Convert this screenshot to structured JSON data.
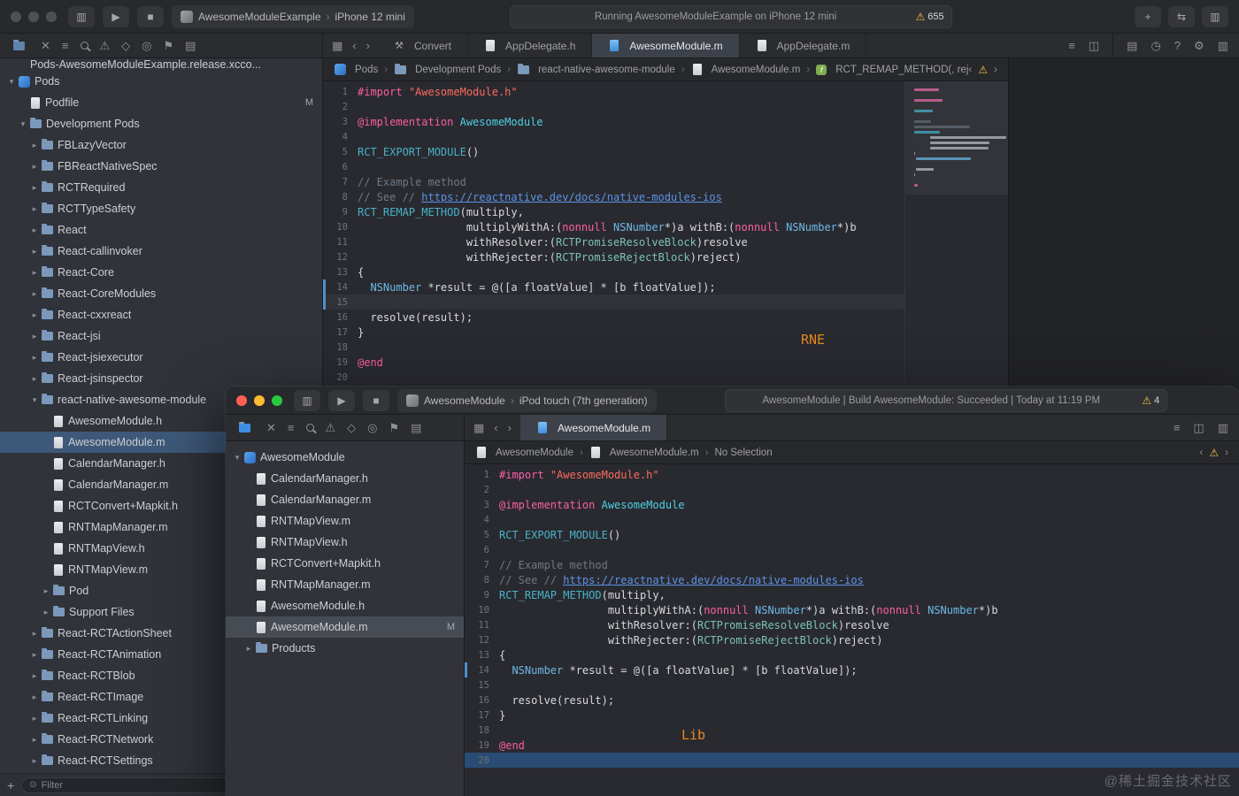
{
  "watermark": "@稀土掘金技术社区",
  "code": {
    "lines": [
      [
        [
          "kw",
          "#import"
        ],
        [
          "pl",
          " "
        ],
        [
          "str",
          "\"AwesomeModule.h\""
        ]
      ],
      [],
      [
        [
          "kw",
          "@implementation"
        ],
        [
          "pl",
          " "
        ],
        [
          "cy",
          "AwesomeModule"
        ]
      ],
      [],
      [
        [
          "mc",
          "RCT_EXPORT_MODULE"
        ],
        [
          "pl",
          "()"
        ]
      ],
      [],
      [
        [
          "cm",
          "// Example method"
        ]
      ],
      [
        [
          "cm",
          "// See // "
        ],
        [
          "lk",
          "https://reactnative.dev/docs/native-modules-ios"
        ]
      ],
      [
        [
          "mc",
          "RCT_REMAP_METHOD"
        ],
        [
          "pl",
          "(multiply,"
        ]
      ],
      [
        [
          "pl",
          "                 multiplyWithA:("
        ],
        [
          "kw",
          "nonnull"
        ],
        [
          "pl",
          " "
        ],
        [
          "ty",
          "NSNumber"
        ],
        [
          "pl",
          "*)a withB:("
        ],
        [
          "kw",
          "nonnull"
        ],
        [
          "pl",
          " "
        ],
        [
          "ty",
          "NSNumber"
        ],
        [
          "pl",
          "*)b"
        ]
      ],
      [
        [
          "pl",
          "                 withResolver:("
        ],
        [
          "tg",
          "RCTPromiseResolveBlock"
        ],
        [
          "pl",
          ")resolve"
        ]
      ],
      [
        [
          "pl",
          "                 withRejecter:("
        ],
        [
          "tg",
          "RCTPromiseRejectBlock"
        ],
        [
          "pl",
          ")reject)"
        ]
      ],
      [
        [
          "pl",
          "{"
        ]
      ],
      [
        [
          "pl",
          "  "
        ],
        [
          "ty",
          "NSNumber"
        ],
        [
          "pl",
          " *result = @([a floatValue] * [b floatValue]);"
        ]
      ],
      [],
      [
        [
          "pl",
          "  resolve(result);"
        ]
      ],
      [
        [
          "pl",
          "}"
        ]
      ],
      [],
      [
        [
          "kw",
          "@end"
        ]
      ],
      []
    ]
  },
  "bg": {
    "scheme": {
      "app": "AwesomeModuleExample",
      "device": "iPhone 12 mini"
    },
    "status": {
      "text": "Running AwesomeModuleExample on iPhone 12 mini",
      "warnings": "655"
    },
    "tabs": [
      {
        "label": "Convert",
        "icon": "tool"
      },
      {
        "label": "AppDelegate.h",
        "icon": "file"
      },
      {
        "label": "AwesomeModule.m",
        "icon": "fileblue",
        "active": true
      },
      {
        "label": "AppDelegate.m",
        "icon": "file"
      }
    ],
    "breadcrumb": [
      {
        "label": "Pods",
        "icon": "project"
      },
      {
        "label": "Development Pods",
        "icon": "folder"
      },
      {
        "label": "react-native-awesome-module",
        "icon": "folder"
      },
      {
        "label": "AwesomeModule.m",
        "icon": "file"
      },
      {
        "label": "RCT_REMAP_METHOD(, reject)",
        "icon": "func"
      }
    ],
    "sidebar": {
      "clipped_item": "Pods-AwesomeModuleExample.release.xcco...",
      "filter_placeholder": "Filter",
      "items": [
        {
          "label": "Pods",
          "depth": 0,
          "icon": "project",
          "chevron": "open"
        },
        {
          "label": "Podfile",
          "depth": 1,
          "icon": "file",
          "badge": "M"
        },
        {
          "label": "Development Pods",
          "depth": 1,
          "icon": "folder",
          "chevron": "open"
        },
        {
          "label": "FBLazyVector",
          "depth": 2,
          "icon": "folder",
          "chevron": "closed"
        },
        {
          "label": "FBReactNativeSpec",
          "depth": 2,
          "icon": "folder",
          "chevron": "closed"
        },
        {
          "label": "RCTRequired",
          "depth": 2,
          "icon": "folder",
          "chevron": "closed"
        },
        {
          "label": "RCTTypeSafety",
          "depth": 2,
          "icon": "folder",
          "chevron": "closed"
        },
        {
          "label": "React",
          "depth": 2,
          "icon": "folder",
          "chevron": "closed"
        },
        {
          "label": "React-callinvoker",
          "depth": 2,
          "icon": "folder",
          "chevron": "closed"
        },
        {
          "label": "React-Core",
          "depth": 2,
          "icon": "folder",
          "chevron": "closed"
        },
        {
          "label": "React-CoreModules",
          "depth": 2,
          "icon": "folder",
          "chevron": "closed"
        },
        {
          "label": "React-cxxreact",
          "depth": 2,
          "icon": "folder",
          "chevron": "closed"
        },
        {
          "label": "React-jsi",
          "depth": 2,
          "icon": "folder",
          "chevron": "closed"
        },
        {
          "label": "React-jsiexecutor",
          "depth": 2,
          "icon": "folder",
          "chevron": "closed"
        },
        {
          "label": "React-jsinspector",
          "depth": 2,
          "icon": "folder",
          "chevron": "closed"
        },
        {
          "label": "react-native-awesome-module",
          "depth": 2,
          "icon": "folder",
          "chevron": "open"
        },
        {
          "label": "AwesomeModule.h",
          "depth": 3,
          "icon": "file"
        },
        {
          "label": "AwesomeModule.m",
          "depth": 3,
          "icon": "file",
          "selected": true
        },
        {
          "label": "CalendarManager.h",
          "depth": 3,
          "icon": "file"
        },
        {
          "label": "CalendarManager.m",
          "depth": 3,
          "icon": "file"
        },
        {
          "label": "RCTConvert+Mapkit.h",
          "depth": 3,
          "icon": "file"
        },
        {
          "label": "RNTMapManager.m",
          "depth": 3,
          "icon": "file"
        },
        {
          "label": "RNTMapView.h",
          "depth": 3,
          "icon": "file"
        },
        {
          "label": "RNTMapView.m",
          "depth": 3,
          "icon": "file"
        },
        {
          "label": "Pod",
          "depth": 3,
          "icon": "folder",
          "chevron": "closed"
        },
        {
          "label": "Support Files",
          "depth": 3,
          "icon": "folder",
          "chevron": "closed"
        },
        {
          "label": "React-RCTActionSheet",
          "depth": 2,
          "icon": "folder",
          "chevron": "closed"
        },
        {
          "label": "React-RCTAnimation",
          "depth": 2,
          "icon": "folder",
          "chevron": "closed"
        },
        {
          "label": "React-RCTBlob",
          "depth": 2,
          "icon": "folder",
          "chevron": "closed"
        },
        {
          "label": "React-RCTImage",
          "depth": 2,
          "icon": "folder",
          "chevron": "closed"
        },
        {
          "label": "React-RCTLinking",
          "depth": 2,
          "icon": "folder",
          "chevron": "closed"
        },
        {
          "label": "React-RCTNetwork",
          "depth": 2,
          "icon": "folder",
          "chevron": "closed"
        },
        {
          "label": "React-RCTSettings",
          "depth": 2,
          "icon": "folder",
          "chevron": "closed"
        }
      ]
    },
    "editor": {
      "overlay": "RNE",
      "change_bars": [
        14,
        15
      ],
      "highlight_line": 15
    }
  },
  "fg": {
    "scheme": {
      "app": "AwesomeModule",
      "device": "iPod touch (7th generation)"
    },
    "status": {
      "text": "AwesomeModule | Build AwesomeModule: Succeeded | Today at 11:19 PM",
      "warnings": "4"
    },
    "tabs": [
      {
        "label": "AwesomeModule.m",
        "icon": "fileblue",
        "active": true
      }
    ],
    "breadcrumb": [
      {
        "label": "AwesomeModule",
        "icon": "file"
      },
      {
        "label": "AwesomeModule.m",
        "icon": "file"
      },
      {
        "label": "No Selection"
      }
    ],
    "sidebar": {
      "items": [
        {
          "label": "AwesomeModule",
          "depth": 0,
          "icon": "project",
          "chevron": "open"
        },
        {
          "label": "CalendarManager.h",
          "depth": 1,
          "icon": "file"
        },
        {
          "label": "CalendarManager.m",
          "depth": 1,
          "icon": "file"
        },
        {
          "label": "RNTMapView.m",
          "depth": 1,
          "icon": "file"
        },
        {
          "label": "RNTMapView.h",
          "depth": 1,
          "icon": "file"
        },
        {
          "label": "RCTConvert+Mapkit.h",
          "depth": 1,
          "icon": "file"
        },
        {
          "label": "RNTMapManager.m",
          "depth": 1,
          "icon": "file"
        },
        {
          "label": "AwesomeModule.h",
          "depth": 1,
          "icon": "file"
        },
        {
          "label": "AwesomeModule.m",
          "depth": 1,
          "icon": "file",
          "selected": true,
          "badge": "M"
        },
        {
          "label": "Products",
          "depth": 1,
          "icon": "folder",
          "chevron": "closed"
        }
      ]
    },
    "editor": {
      "overlay": "Lib",
      "change_bars": [
        14
      ],
      "selected_line": 20
    }
  }
}
